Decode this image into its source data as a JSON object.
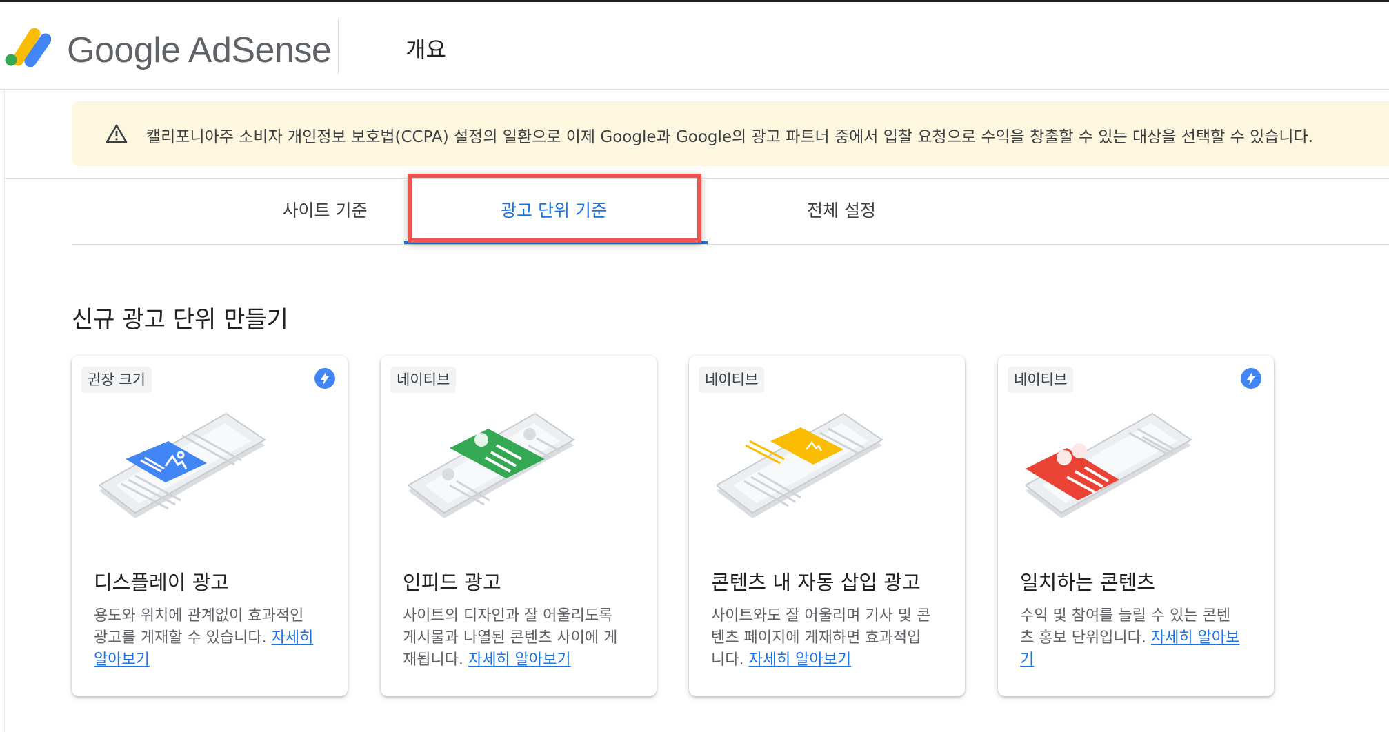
{
  "header": {
    "brand": "Google AdSense",
    "title": "개요"
  },
  "notice": {
    "text": "캘리포니아주 소비자 개인정보 보호법(CCPA) 설정의 일환으로 이제 Google과 Google의 광고 파트너 중에서 입찰 요청으로 수익을 창출할 수 있는 대상을 선택할 수 있습니다."
  },
  "tabs": [
    {
      "label": "사이트 기준",
      "selected": false
    },
    {
      "label": "광고 단위 기준",
      "selected": true
    },
    {
      "label": "전체 설정",
      "selected": false
    }
  ],
  "section": {
    "title": "신규 광고 단위 만들기"
  },
  "cards": [
    {
      "chip": "권장 크기",
      "bolt": true,
      "title": "디스플레이 광고",
      "desc_lines": [
        "용도와 위치에 관계없이 효과적인",
        "광고를 게재할 수 있습니다. "
      ],
      "link_lines": [
        "자세히",
        "알아보기"
      ]
    },
    {
      "chip": "네이티브",
      "bolt": false,
      "title": "인피드 광고",
      "desc_lines": [
        "사이트의 디자인과 잘 어울리도록",
        "게시물과 나열된 콘텐츠 사이에 게",
        "재됩니다. "
      ],
      "link_lines": [
        "자세히 알아보기"
      ]
    },
    {
      "chip": "네이티브",
      "bolt": false,
      "title": "콘텐츠 내 자동 삽입 광고",
      "desc_lines": [
        "사이트와도 잘 어울리며 기사 및 콘",
        "텐츠 페이지에 게재하면 효과적입",
        "니다. "
      ],
      "link_lines": [
        "자세히 알아보기"
      ]
    },
    {
      "chip": "네이티브",
      "bolt": true,
      "title": "일치하는 콘텐츠",
      "desc_lines": [
        "수익 및 참여를 늘릴 수 있는 콘텐",
        "츠 홍보 단위입니다. "
      ],
      "link_lines": [
        "자세히 알아보",
        "기"
      ]
    }
  ],
  "colors": {
    "accent": "#1a73e8",
    "highlight": "#ef5350",
    "notice_bg": "#fef7e0",
    "display_ad": "#4285f4",
    "infeed_ad": "#34a853",
    "inarticle_ad": "#fbbc04",
    "matched_content": "#ea4335"
  },
  "icons": [
    "adsense-logo-icon",
    "warning-icon",
    "bolt-icon"
  ]
}
